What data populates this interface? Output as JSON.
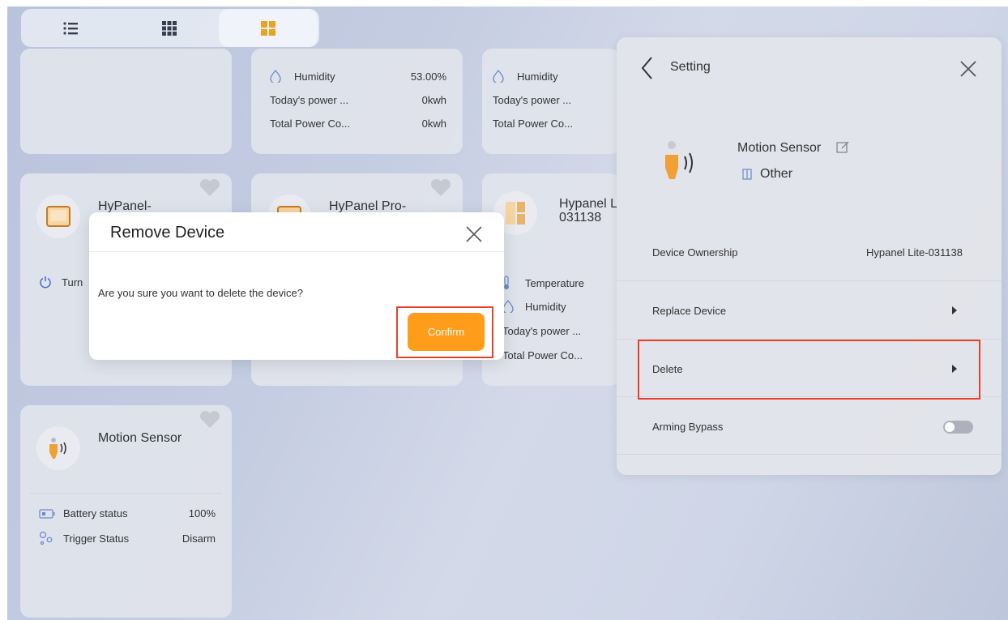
{
  "view_switcher": {
    "modes": [
      "list-icon",
      "grid-small-icon",
      "grid-large-icon"
    ],
    "active": "grid-large"
  },
  "cards": {
    "top_mid": {
      "rows": [
        {
          "label": "Humidity",
          "value": "53.00%"
        },
        {
          "label": "Today's power ...",
          "value": "0kwh"
        },
        {
          "label": "Total Power Co...",
          "value": "0kwh"
        }
      ]
    },
    "top_right": {
      "rows": [
        {
          "label": "Humidity",
          "value": ""
        },
        {
          "label": "Today's power ...",
          "value": ""
        },
        {
          "label": "Total Power Co...",
          "value": ""
        }
      ]
    },
    "hypanel_1": {
      "title": "HyPanel-",
      "row_label": "Turn"
    },
    "hypanel_pro": {
      "title": "HyPanel Pro-"
    },
    "hypanel_lite": {
      "title_line1": "Hypanel L",
      "title_line2": "031138",
      "rows": [
        "Temperature",
        "Humidity",
        "Today's power ...",
        "Total Power Co..."
      ]
    },
    "motion": {
      "title": "Motion Sensor",
      "rows": [
        {
          "label": "Battery status",
          "value": "100%"
        },
        {
          "label": "Trigger Status",
          "value": "Disarm"
        }
      ]
    }
  },
  "dialog": {
    "title": "Remove Device",
    "message": "Are you sure you want to delete the device?",
    "confirm_label": "Confirm"
  },
  "panel": {
    "title": "Setting",
    "device_name": "Motion Sensor",
    "room": "Other",
    "rows": {
      "ownership_label": "Device Ownership",
      "ownership_value": "Hypanel Lite-031138",
      "replace_label": "Replace Device",
      "delete_label": "Delete",
      "arming_label": "Arming Bypass"
    },
    "arming_bypass_on": false
  },
  "colors": {
    "accent": "#ff9c1a",
    "highlight": "#e8402a",
    "device_orange": "#f0a035"
  }
}
